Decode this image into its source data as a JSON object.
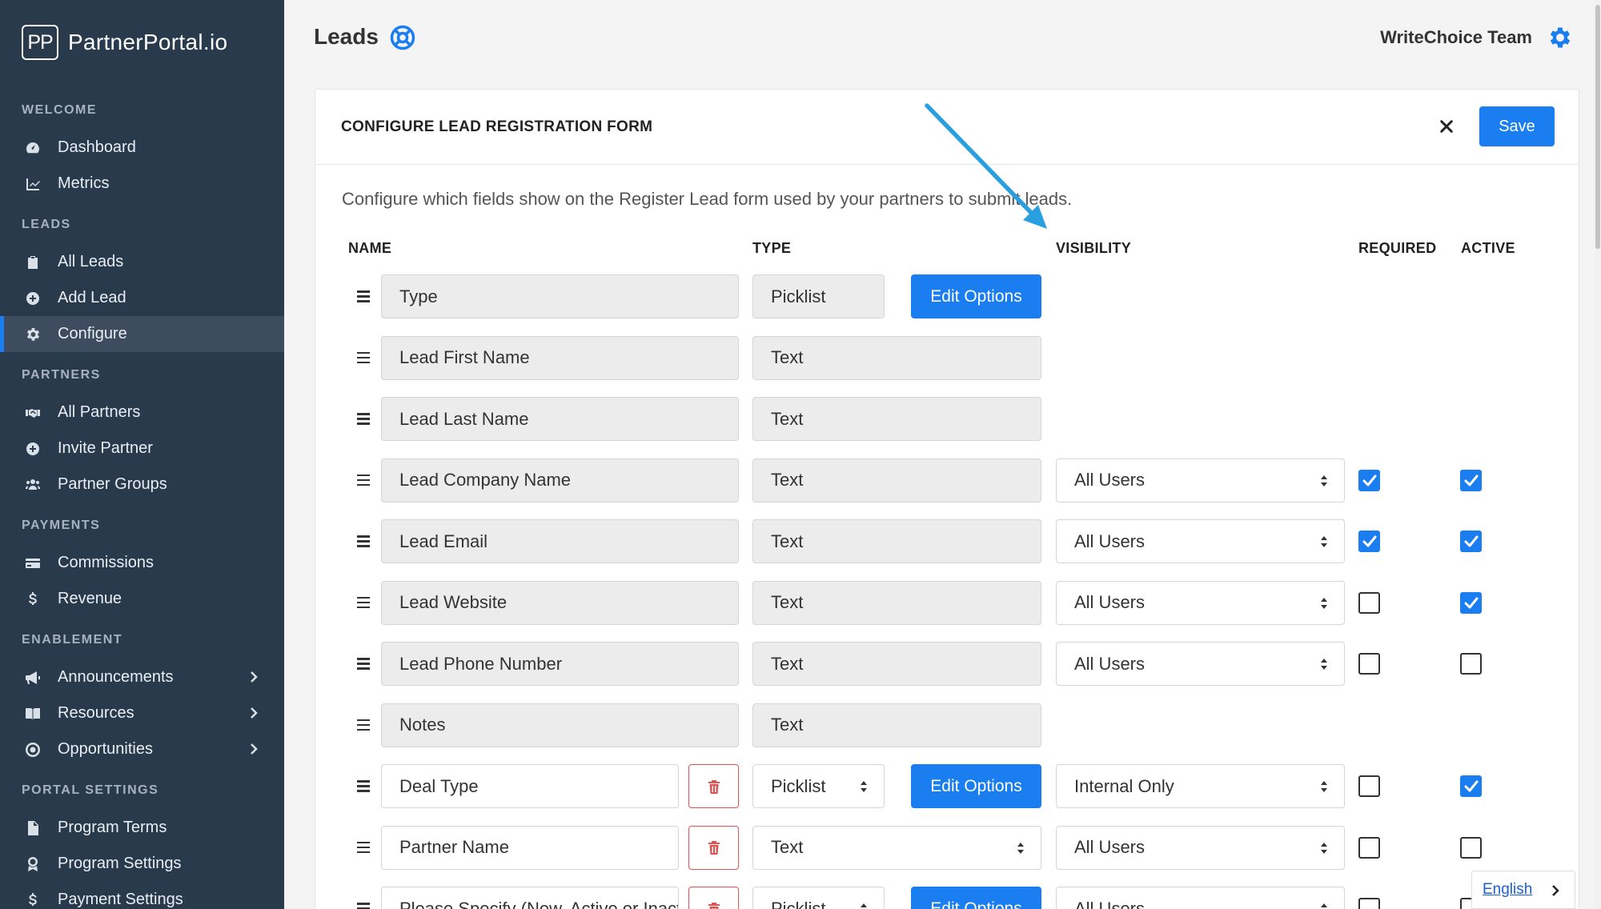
{
  "brand": {
    "logo": "PP",
    "name": "PartnerPortal.io"
  },
  "sidebar": {
    "sections": [
      {
        "label": "WELCOME",
        "items": [
          {
            "label": "Dashboard",
            "icon": "gauge-icon"
          },
          {
            "label": "Metrics",
            "icon": "chart-line-icon"
          }
        ]
      },
      {
        "label": "LEADS",
        "items": [
          {
            "label": "All Leads",
            "icon": "clipboard-icon"
          },
          {
            "label": "Add Lead",
            "icon": "plus-circle-icon"
          },
          {
            "label": "Configure",
            "icon": "gear-icon",
            "active": true
          }
        ]
      },
      {
        "label": "PARTNERS",
        "items": [
          {
            "label": "All Partners",
            "icon": "handshake-icon"
          },
          {
            "label": "Invite Partner",
            "icon": "plus-circle-icon"
          },
          {
            "label": "Partner Groups",
            "icon": "users-icon"
          }
        ]
      },
      {
        "label": "PAYMENTS",
        "items": [
          {
            "label": "Commissions",
            "icon": "credit-card-icon"
          },
          {
            "label": "Revenue",
            "icon": "dollar-icon"
          }
        ]
      },
      {
        "label": "ENABLEMENT",
        "items": [
          {
            "label": "Announcements",
            "icon": "megaphone-icon",
            "chevron": true
          },
          {
            "label": "Resources",
            "icon": "book-icon",
            "chevron": true
          },
          {
            "label": "Opportunities",
            "icon": "target-icon",
            "chevron": true
          }
        ]
      },
      {
        "label": "PORTAL SETTINGS",
        "items": [
          {
            "label": "Program Terms",
            "icon": "file-icon"
          },
          {
            "label": "Program Settings",
            "icon": "award-icon"
          },
          {
            "label": "Payment Settings",
            "icon": "dollar-icon"
          }
        ]
      }
    ]
  },
  "header": {
    "title": "Leads",
    "team": "WriteChoice Team"
  },
  "card": {
    "title": "CONFIGURE LEAD REGISTRATION FORM",
    "save_label": "Save",
    "description": "Configure which fields show on the Register Lead form used by your partners to submit leads.",
    "columns": {
      "name": "NAME",
      "type": "TYPE",
      "visibility": "VISIBILITY",
      "required": "REQUIRED",
      "active": "ACTIVE"
    },
    "edit_options_label": "Edit Options",
    "rows": [
      {
        "name": "Type",
        "type": "Picklist",
        "custom": false,
        "edit": true,
        "visibility": null
      },
      {
        "name": "Lead First Name",
        "type": "Text",
        "custom": false,
        "visibility": null
      },
      {
        "name": "Lead Last Name",
        "type": "Text",
        "custom": false,
        "visibility": null
      },
      {
        "name": "Lead Company Name",
        "type": "Text",
        "custom": false,
        "visibility": "All Users",
        "required": true,
        "active": true
      },
      {
        "name": "Lead Email",
        "type": "Text",
        "custom": false,
        "visibility": "All Users",
        "required": true,
        "active": true
      },
      {
        "name": "Lead Website",
        "type": "Text",
        "custom": false,
        "visibility": "All Users",
        "required": false,
        "active": true
      },
      {
        "name": "Lead Phone Number",
        "type": "Text",
        "custom": false,
        "visibility": "All Users",
        "required": false,
        "active": false
      },
      {
        "name": "Notes",
        "type": "Text",
        "custom": false,
        "visibility": null
      },
      {
        "name": "Deal Type",
        "type": "Picklist",
        "custom": true,
        "edit": true,
        "visibility": "Internal Only",
        "required": false,
        "active": true
      },
      {
        "name": "Partner Name",
        "type": "Text",
        "custom": true,
        "edit": false,
        "visibility": "All Users",
        "required": false,
        "active": false
      },
      {
        "name": "Please Specify (New, Active or Inactive)",
        "type": "Picklist",
        "custom": true,
        "edit": true,
        "visibility": "All Users",
        "required": false,
        "active": false
      }
    ]
  },
  "language": {
    "label": "English"
  },
  "colors": {
    "accent": "#1a7df0",
    "sidebar": "#2a3a4d",
    "annotation_arrow": "#2a9fe0",
    "delete": "#e05252"
  }
}
